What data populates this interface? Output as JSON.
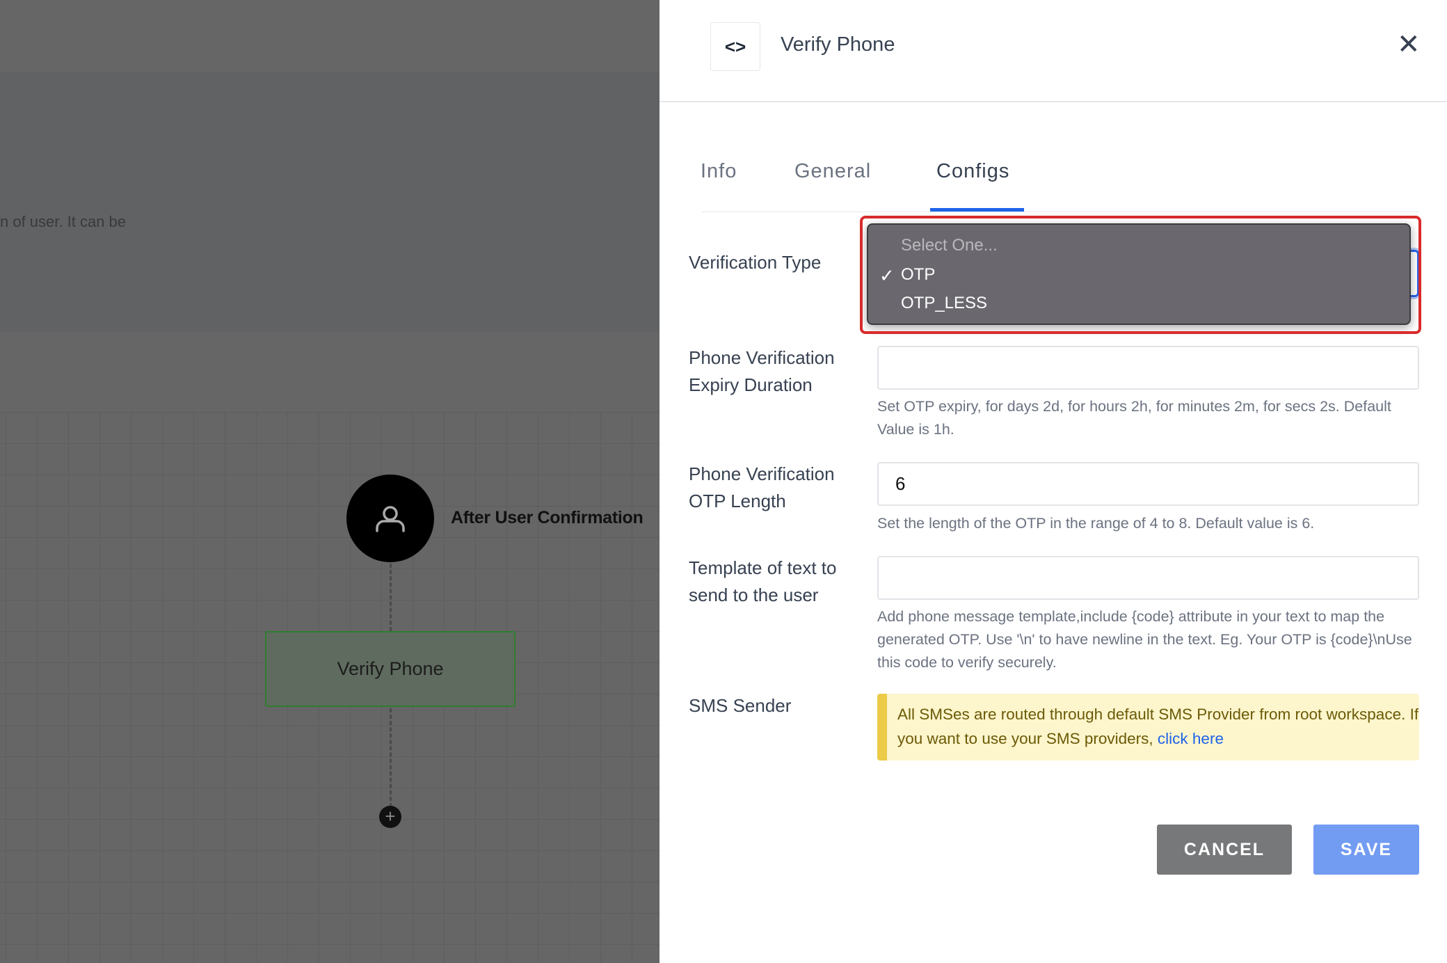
{
  "canvas": {
    "description_fragment": "n of user. It can be",
    "trigger_label": "After User Confirmation",
    "node_label": "Verify Phone",
    "icons": {
      "trigger": "user-icon",
      "add": "plus-icon"
    }
  },
  "panel": {
    "title": "Verify Phone",
    "header_icon": "code-brackets-icon",
    "close_icon": "close-icon",
    "tabs": [
      {
        "label": "Info"
      },
      {
        "label": "General"
      },
      {
        "label": "Configs",
        "active": true
      }
    ],
    "fields": {
      "verification_type": {
        "label": "Verification Type",
        "options": [
          "Select One...",
          "OTP",
          "OTP_LESS"
        ],
        "selected": "OTP"
      },
      "expiry": {
        "label_line1": "Phone Verification",
        "label_line2": "Expiry Duration",
        "value": "",
        "help": "Set OTP expiry, for days 2d, for hours 2h, for minutes 2m, for secs 2s. Default Value is 1h."
      },
      "otp_length": {
        "label_line1": "Phone Verification",
        "label_line2": "OTP Length",
        "value": "6",
        "help": "Set the length of the OTP in the range of 4 to 8. Default value is 6."
      },
      "template": {
        "label_line1": "Template of text to",
        "label_line2": "send to the user",
        "value": "",
        "help": "Add phone message template,include {code} attribute in your text to map the generated OTP. Use '\\n' to have newline in the text. Eg. Your OTP is {code}\\nUse this code to verify securely."
      },
      "sms_sender": {
        "label": "SMS Sender",
        "notice": "All SMSes are routed through default SMS Provider from root workspace. If you want to use your SMS providers, ",
        "link": "click here"
      }
    },
    "buttons": {
      "cancel": "CANCEL",
      "save": "SAVE"
    },
    "colors": {
      "accent": "#1e63e9",
      "save": "#729bf2",
      "cancel": "#77787a",
      "notice_bg": "#fdf5cc",
      "notice_bar": "#eccb48",
      "highlight": "#d92b2b"
    }
  }
}
